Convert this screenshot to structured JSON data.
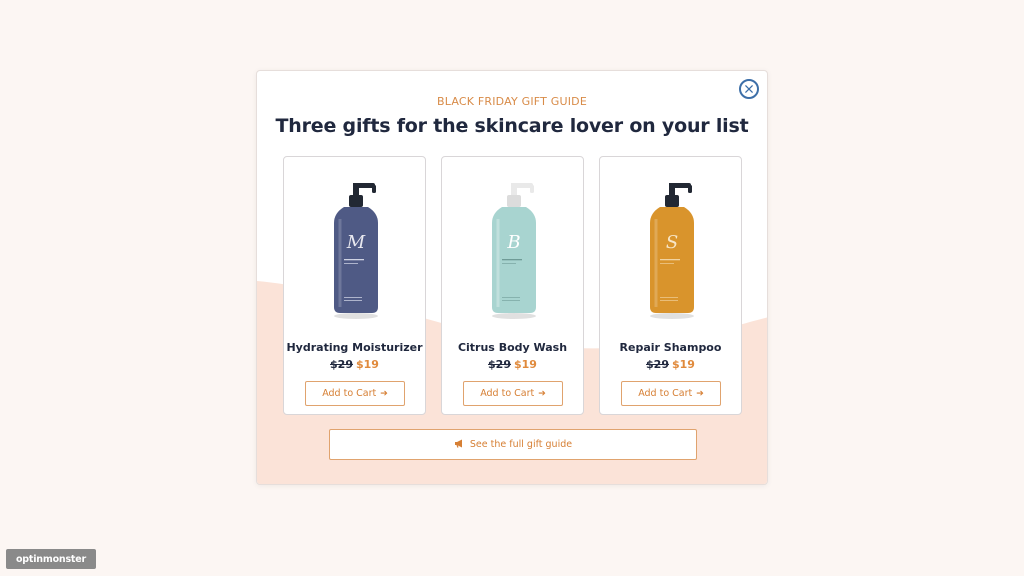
{
  "popup": {
    "eyebrow": "BLACK FRIDAY GIFT GUIDE",
    "headline": "Three gifts for the skincare lover on your list",
    "close_icon": "close-icon"
  },
  "products": [
    {
      "name": "Hydrating Moisturizer",
      "old_price": "$29",
      "new_price": "$19",
      "cta": "Add to Cart",
      "bottle_color": "#4f5a85",
      "pump_color": "#222833",
      "monogram": "M"
    },
    {
      "name": "Citrus Body Wash",
      "old_price": "$29",
      "new_price": "$19",
      "cta": "Add to Cart",
      "bottle_color": "#a8d4d0",
      "pump_color": "#e9e9e9",
      "monogram": "B"
    },
    {
      "name": "Repair Shampoo",
      "old_price": "$29",
      "new_price": "$19",
      "cta": "Add to Cart",
      "bottle_color": "#d9942c",
      "pump_color": "#222833",
      "monogram": "S"
    }
  ],
  "footer_button": {
    "label": "See the full gift guide",
    "icon": "megaphone-icon"
  },
  "branding": {
    "label": "optinmonster"
  },
  "colors": {
    "accent": "#d88b48",
    "headline": "#20283e",
    "sale_price": "#e08a3c",
    "backdrop": "#fcf6f3",
    "wave": "#fbe3d8"
  }
}
